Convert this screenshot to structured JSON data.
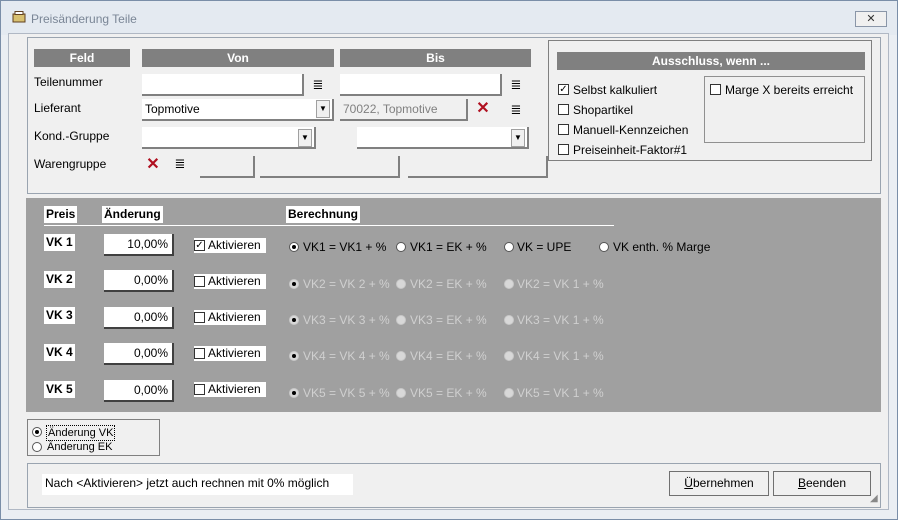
{
  "window": {
    "title": "Preisänderung Teile",
    "close_label": "✕"
  },
  "headers": {
    "feld": "Feld",
    "von": "Von",
    "bis": "Bis"
  },
  "rows": {
    "teilenummer": {
      "label": "Teilenummer",
      "von": "",
      "bis": ""
    },
    "lieferant": {
      "label": "Lieferant",
      "von": "Topmotive",
      "bis": "70022, Topmotive"
    },
    "kond": {
      "label": "Kond.-Gruppe",
      "von": "",
      "bis": ""
    },
    "waren": {
      "label": "Warengruppe"
    }
  },
  "ausschluss": {
    "title": "Ausschluss, wenn ...",
    "selbst": {
      "label": "Selbst kalkuliert",
      "checked": true
    },
    "shop": {
      "label": "Shopartikel",
      "checked": false
    },
    "manuell": {
      "label": "Manuell-Kennzeichen",
      "checked": false
    },
    "preiseinheit": {
      "label": "Preiseinheit-Faktor#1",
      "checked": false
    },
    "marge": {
      "label": "Marge X bereits erreicht",
      "checked": false
    }
  },
  "preis": {
    "col_preis": "Preis",
    "col_aenderung": "Änderung",
    "col_berechnung": "Berechnung",
    "activate_label": "Aktivieren",
    "rows": [
      {
        "label": "VK 1",
        "value": "10,00%",
        "active": true,
        "opts": [
          "VK1 = VK1 + %",
          "VK1 = EK + %",
          "VK = UPE",
          "VK enth. % Marge"
        ]
      },
      {
        "label": "VK 2",
        "value": "0,00%",
        "active": false,
        "opts": [
          "VK2 = VK 2 +  %",
          "VK2 = EK + %",
          "VK2 = VK 1 + %"
        ]
      },
      {
        "label": "VK 3",
        "value": "0,00%",
        "active": false,
        "opts": [
          "VK3 = VK 3 +  %",
          "VK3 = EK + %",
          "VK3  = VK 1 + %"
        ]
      },
      {
        "label": "VK 4",
        "value": "0,00%",
        "active": false,
        "opts": [
          "VK4 = VK 4 +  %",
          "VK4 = EK + %",
          "VK4 = VK 1 + %"
        ]
      },
      {
        "label": "VK 5",
        "value": "0,00%",
        "active": false,
        "opts": [
          "VK5 = VK 5 +  %",
          "VK5 = EK + %",
          "VK5 = VK 1 + %"
        ]
      }
    ]
  },
  "mode": {
    "vk": "Änderung VK",
    "ek": "Änderung EK",
    "selected": "vk"
  },
  "footer": {
    "hint": "Nach <Aktivieren> jetzt auch rechnen mit 0% möglich",
    "uebernehmen_u": "Ü",
    "uebernehmen_rest": "bernehmen",
    "beenden_u": "B",
    "beenden_rest": "eenden"
  }
}
